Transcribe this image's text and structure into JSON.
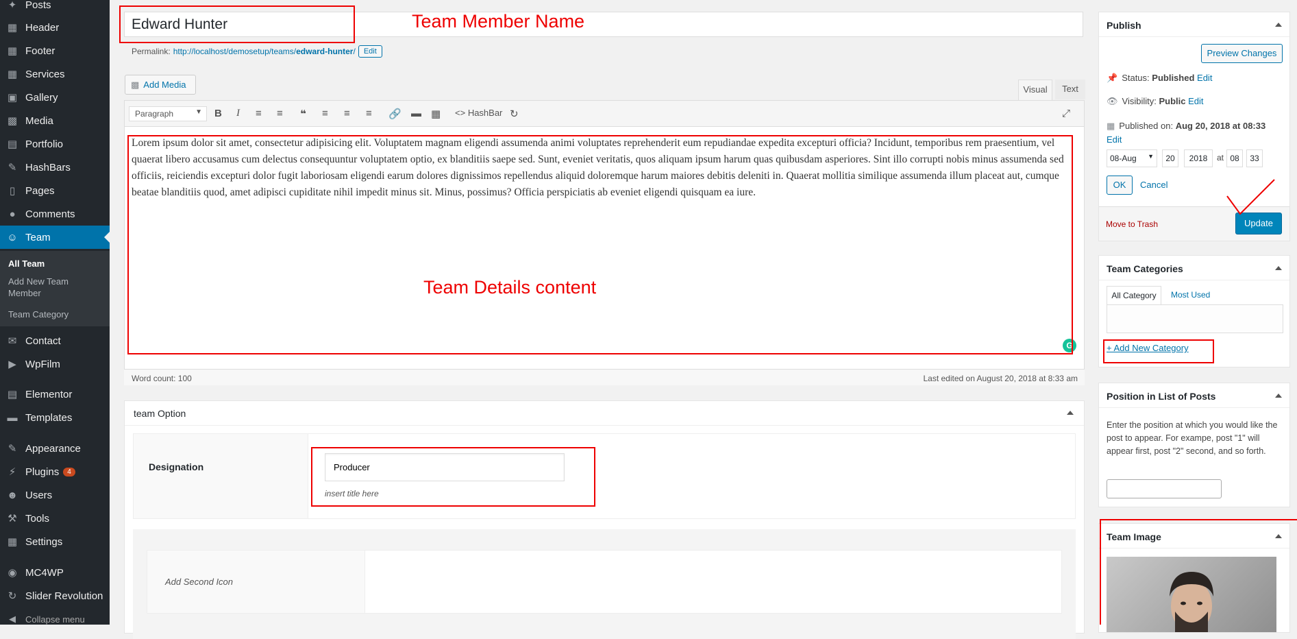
{
  "sidebar": {
    "items": [
      {
        "label": "Posts",
        "icon": "pin-icon"
      },
      {
        "label": "Header",
        "icon": "grid-icon"
      },
      {
        "label": "Footer",
        "icon": "grid-icon"
      },
      {
        "label": "Services",
        "icon": "grid-icon"
      },
      {
        "label": "Gallery",
        "icon": "gallery-icon"
      },
      {
        "label": "Media",
        "icon": "media-icon"
      },
      {
        "label": "Portfolio",
        "icon": "portfolio-icon"
      },
      {
        "label": "HashBars",
        "icon": "chat-icon"
      },
      {
        "label": "Pages",
        "icon": "page-icon"
      },
      {
        "label": "Comments",
        "icon": "comment-icon"
      },
      {
        "label": "Team",
        "icon": "team-icon"
      },
      {
        "label": "Contact",
        "icon": "mail-icon"
      },
      {
        "label": "WpFilm",
        "icon": "film-icon"
      },
      {
        "label": "Elementor",
        "icon": "elementor-icon"
      },
      {
        "label": "Templates",
        "icon": "folder-icon"
      },
      {
        "label": "Appearance",
        "icon": "brush-icon"
      },
      {
        "label": "Plugins",
        "icon": "plug-icon",
        "badge": "4"
      },
      {
        "label": "Users",
        "icon": "user-icon"
      },
      {
        "label": "Tools",
        "icon": "wrench-icon"
      },
      {
        "label": "Settings",
        "icon": "settings-icon"
      },
      {
        "label": "MC4WP",
        "icon": "mc4wp-icon"
      },
      {
        "label": "Slider Revolution",
        "icon": "refresh-icon"
      },
      {
        "label": "Collapse menu",
        "icon": "collapse-icon"
      }
    ],
    "submenu": [
      "All Team",
      "Add New Team Member",
      "Team Category"
    ]
  },
  "title": {
    "value": "Edward Hunter"
  },
  "annotations": {
    "name_label": "Team Member Name",
    "content_label": "Team Details content"
  },
  "permalink": {
    "label": "Permalink:",
    "base": "http://localhost/demosetup/teams/",
    "slug": "edward-hunter",
    "trail": "/",
    "edit": "Edit"
  },
  "editor": {
    "add_media": "Add Media",
    "tab_visual": "Visual",
    "tab_text": "Text",
    "format": "Paragraph",
    "hashbar": "HashBar",
    "content": "Lorem ipsum dolor sit amet, consectetur adipisicing elit. Voluptatem magnam eligendi assumenda animi voluptates reprehenderit eum repudiandae expedita excepturi officia? Incidunt, temporibus rem praesentium, vel quaerat libero accusamus cum delectus consequuntur voluptatem optio, ex blanditiis saepe sed. Sunt, eveniet veritatis, quos aliquam ipsum harum quas quibusdam asperiores. Sint illo corrupti nobis minus assumenda sed officiis, reiciendis excepturi dolor fugit laboriosam eligendi earum dolores dignissimos repellendus aliquid doloremque harum maiores debitis deleniti in. Quaerat mollitia similique assumenda illum placeat aut, cumque beatae blanditiis quod, amet adipisci cupiditate nihil impedit minus sit. Minus, possimus? Officia perspiciatis ab eveniet eligendi quisquam ea iure.",
    "word_count": "Word count: 100",
    "last_edited": "Last edited on August 20, 2018 at 8:33 am"
  },
  "team_option": {
    "title": "team Option",
    "designation_label": "Designation",
    "designation_value": "Producer",
    "designation_hint": "insert title here",
    "second_icon": "Add Second Icon"
  },
  "publish": {
    "title": "Publish",
    "preview": "Preview Changes",
    "status_label": "Status:",
    "status_value": "Published",
    "visibility_label": "Visibility:",
    "visibility_value": "Public",
    "published_on_label": "Published on:",
    "published_on_value": "Aug 20, 2018 at 08:33",
    "edit": "Edit",
    "month": "08-Aug",
    "day": "20",
    "year": "2018",
    "at": "at",
    "hour": "08",
    "minute": "33",
    "ok": "OK",
    "cancel": "Cancel",
    "trash": "Move to Trash",
    "update": "Update"
  },
  "categories": {
    "title": "Team Categories",
    "tab_all": "All Category",
    "tab_used": "Most Used",
    "add_new": "+ Add New Category"
  },
  "position": {
    "title": "Position in List of Posts",
    "description": "Enter the position at which you would like the post to appear. For exampe, post \"1\" will appear first, post \"2\" second, and so forth."
  },
  "team_image": {
    "title": "Team Image"
  }
}
